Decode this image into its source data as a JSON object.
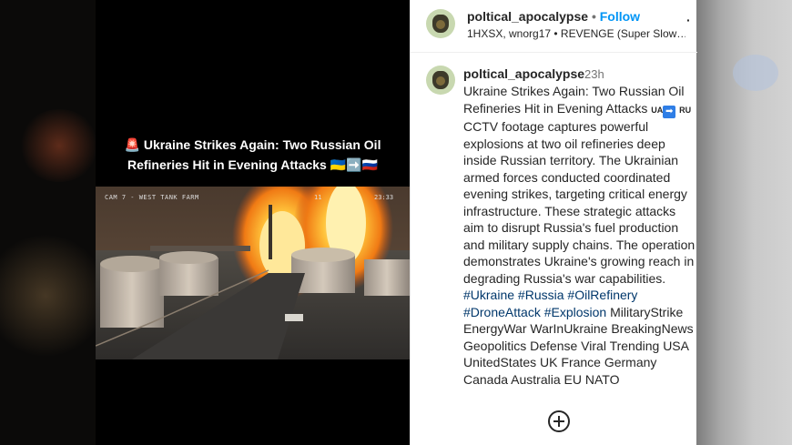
{
  "video": {
    "caption_line1": "🚨 Ukraine Strikes Again: Two Russian Oil",
    "caption_line2": "Refineries Hit in Evening Attacks 🇺🇦➡️🇷🇺",
    "cam_label": "CAM 7 - WEST TANK FARM",
    "cam_num": "11",
    "cam_time": "23:33"
  },
  "header": {
    "username": "poltical_apocalypse",
    "separator": "•",
    "follow_label": "Follow",
    "audio_line": "1HXSX, wnorg17 • REVENGE (Super Slow…",
    "more_label": "·"
  },
  "comment": {
    "username": "poltical_apocalypse",
    "time": "23h",
    "text_part1": "Ukraine Strikes Again: Two Russian Oil Refineries Hit in Evening Attacks",
    "flag_ua": "UA",
    "arrow": "➡",
    "flag_ru": "RU",
    "text_part2": "CCTV footage captures powerful explosions at two oil refineries deep inside Russian territory. The Ukrainian armed forces conducted coordinated evening strikes, targeting critical energy infrastructure. These strategic attacks aim to disrupt Russia's fuel production and military supply chains. The operation demonstrates Ukraine's growing reach in degrading Russia's war capabilities.",
    "hashtags": [
      "#Ukraine",
      "#Russia",
      "#OilRefinery",
      "#DroneAttack",
      "#Explosion"
    ],
    "keywords": "MilitaryStrike EnergyWar WarInUkraine BreakingNews Geopolitics Defense Viral Trending USA UnitedStates UK France Germany Canada Australia EU NATO"
  },
  "colors": {
    "follow": "#0095f6",
    "hashtag": "#00376b",
    "text": "#262626",
    "muted": "#737373"
  },
  "icons": {
    "add_comment": "plus-circle-icon"
  }
}
